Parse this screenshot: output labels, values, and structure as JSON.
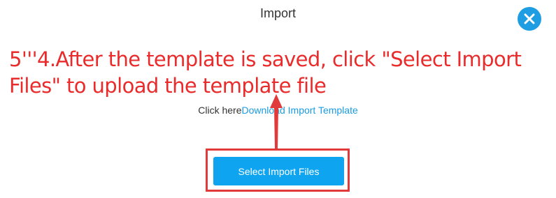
{
  "dialog": {
    "title": "Import",
    "close_icon": "close-icon"
  },
  "annotation": {
    "text": "5'''4.After the template is saved, click \"Select Import Files\" to upload the template file",
    "color": "#ea2b2b"
  },
  "download": {
    "prefix": "Click here",
    "link_label": "Download Import Template"
  },
  "actions": {
    "select_files_label": "Select Import Files"
  },
  "colors": {
    "accent": "#0ea4ef",
    "link": "#1a9ce0",
    "highlight": "#e03a3a"
  }
}
